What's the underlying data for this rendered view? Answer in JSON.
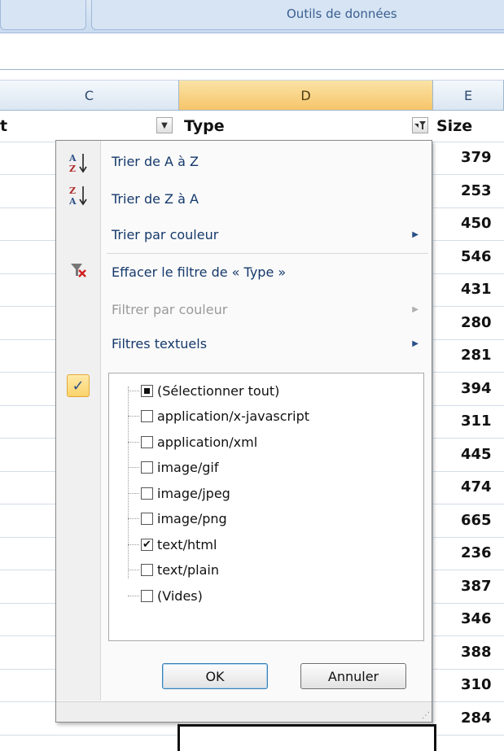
{
  "ribbon": {
    "group_label": "Outils de données"
  },
  "columns": {
    "c": "C",
    "d": "D",
    "e": "E"
  },
  "header_row": {
    "c_label": "t",
    "d_label": "Type",
    "e_label": "Size"
  },
  "sizes": [
    "379",
    "253",
    "450",
    "546",
    "431",
    "280",
    "281",
    "394",
    "311",
    "445",
    "474",
    "665",
    "236",
    "387",
    "346",
    "388",
    "310",
    "284"
  ],
  "menu": {
    "sort_az": "Trier de A à Z",
    "sort_za": "Trier de Z à A",
    "sort_color": "Trier par couleur",
    "clear_filter": "Effacer le filtre de « Type »",
    "filter_color": "Filtrer par couleur",
    "text_filters": "Filtres textuels",
    "list": [
      {
        "label": "(Sélectionner tout)",
        "state": "partial"
      },
      {
        "label": "application/x-javascript",
        "state": "unchecked"
      },
      {
        "label": "application/xml",
        "state": "unchecked"
      },
      {
        "label": "image/gif",
        "state": "unchecked"
      },
      {
        "label": "image/jpeg",
        "state": "unchecked"
      },
      {
        "label": "image/png",
        "state": "unchecked"
      },
      {
        "label": "text/html",
        "state": "checked"
      },
      {
        "label": "text/plain",
        "state": "unchecked"
      },
      {
        "label": "(Vides)",
        "state": "unchecked"
      }
    ],
    "ok_label": "OK",
    "cancel_label": "Annuler"
  },
  "icons": {
    "sort_az": "sort-az-icon",
    "sort_za": "sort-za-icon",
    "clear_filter": "clear-filter-icon",
    "check": "check-icon",
    "submenu_arrow": "chevron-right-icon",
    "filter_dropdown": "filter-dropdown-icon"
  },
  "colors": {
    "selected_column": "#f6c56a",
    "menu_text": "#15396b",
    "disabled_text": "#9a9a9a"
  }
}
